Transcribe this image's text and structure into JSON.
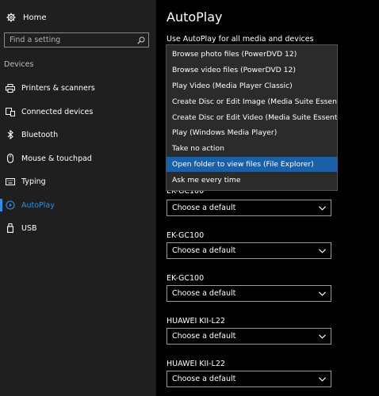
{
  "sidebar": {
    "home_label": "Home",
    "search_placeholder": "Find a setting",
    "section_label": "Devices",
    "items": [
      {
        "label": "Printers & scanners",
        "icon": "printer-icon"
      },
      {
        "label": "Connected devices",
        "icon": "connected-devices-icon"
      },
      {
        "label": "Bluetooth",
        "icon": "bluetooth-icon"
      },
      {
        "label": "Mouse & touchpad",
        "icon": "mouse-icon"
      },
      {
        "label": "Typing",
        "icon": "keyboard-icon"
      },
      {
        "label": "AutoPlay",
        "icon": "autoplay-icon",
        "active": true
      },
      {
        "label": "USB",
        "icon": "usb-icon"
      }
    ]
  },
  "main": {
    "title": "AutoPlay",
    "section_heading": "Use AutoPlay for all media and devices",
    "dropdown_options": [
      "Browse photo files (PowerDVD 12)",
      "Browse video files (PowerDVD 12)",
      "Play Video (Media Player Classic)",
      "Create Disc or Edit Image (Media Suite Essentials)",
      "Create Disc or Edit Video (Media Suite Essentials)",
      "Play (Windows Media Player)",
      "Take no action",
      "Open folder to view files (File Explorer)",
      "Ask me every time"
    ],
    "dropdown_selected_index": 7,
    "devices": [
      {
        "label": "EK-GC100",
        "value": "Choose a default"
      },
      {
        "label": "EK-GC100",
        "value": "Choose a default"
      },
      {
        "label": "EK-GC100",
        "value": "Choose a default"
      },
      {
        "label": "HUAWEI KII-L22",
        "value": "Choose a default"
      },
      {
        "label": "HUAWEI KII-L22",
        "value": "Choose a default"
      }
    ]
  },
  "colors": {
    "accent": "#2e8fe4",
    "selected_option": "#1b5fa6",
    "sidebar_bg": "#1f1f1f",
    "main_bg": "#000000"
  }
}
